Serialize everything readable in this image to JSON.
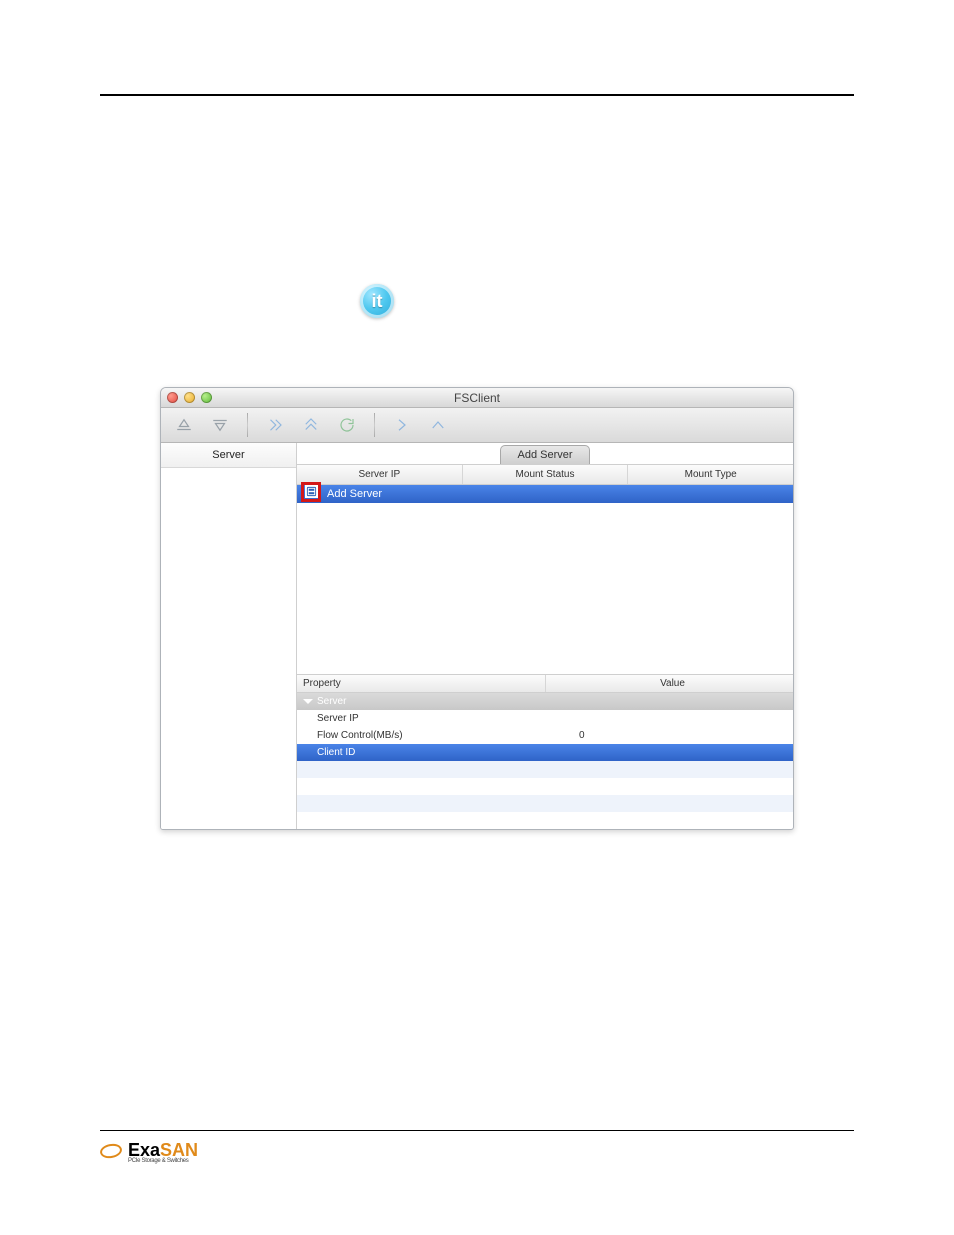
{
  "window": {
    "title": "FSClient"
  },
  "sidebar": {
    "header": "Server"
  },
  "tabs": {
    "add_server": "Add Server"
  },
  "server_table": {
    "columns": [
      "Server IP",
      "Mount Status",
      "Mount Type"
    ],
    "context_menu_item": "Add Server"
  },
  "property_table": {
    "col_property": "Property",
    "col_value": "Value",
    "group": "Server",
    "rows": [
      {
        "key": "Server IP",
        "value": ""
      },
      {
        "key": "Flow Control(MB/s)",
        "value": "0"
      },
      {
        "key": "Client ID",
        "value": ""
      }
    ]
  },
  "info_icon_label": "it",
  "footer": {
    "brand_a": "Exa",
    "brand_b": "SAN",
    "tagline": "PCIe Storage & Switches"
  }
}
